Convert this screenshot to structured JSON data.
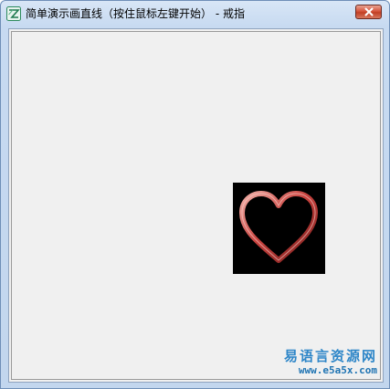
{
  "window": {
    "title": "简单演示画直线（按住鼠标左键开始） - 戒指",
    "icon": "app-icon",
    "close_icon": "close-icon"
  },
  "canvas": {
    "image": "heart-ring-image",
    "heart_color": "#c94a48",
    "background_color": "#000000"
  },
  "watermark": {
    "line1": "易语言资源网",
    "line2": "www.e5a5x.com"
  }
}
